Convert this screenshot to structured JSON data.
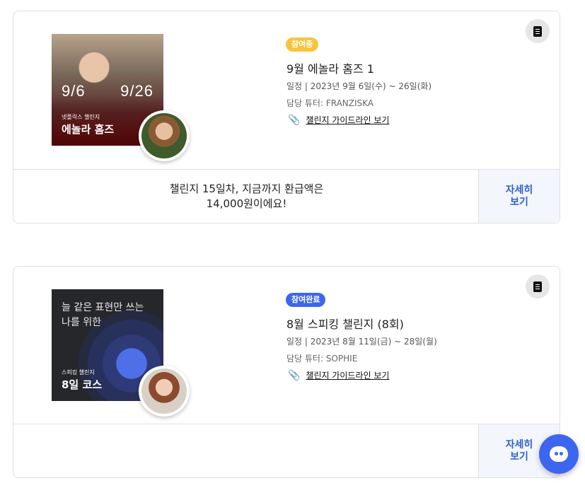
{
  "challenges": [
    {
      "badge": "참여중",
      "badge_color": "#f9c43a",
      "title": "9월 에놀라 홈즈 1",
      "schedule": "일정 |   2023년 9월 6일(수) ~ 26일(화)",
      "tutor": "담당 튜터: FRANZISKA",
      "guide_label": "챌린지 가이드라인 보기",
      "thumb": {
        "date_start": "9/6",
        "date_end": "9/26",
        "small_text": "넷플릭스 챌린지",
        "big_text": "에놀라 홈즈"
      },
      "refund_line1": "챌린지 15일차, 지금까지 환급액은",
      "refund_line2": "14,000원이에요!",
      "detail_line1": "자세히",
      "detail_line2": "보기"
    },
    {
      "badge": "참여완료",
      "badge_color": "#3d66f0",
      "title": "8월 스피킹 챌린지 (8회)",
      "schedule": "일정 |   2023년 8월 11일(금) ~ 28일(월)",
      "tutor": "담당 튜터: SOPHIE",
      "guide_label": "챌린지 가이드라인 보기",
      "thumb": {
        "head_line1": "늘 같은 표현만 쓰는",
        "head_line2": "나를 위한",
        "small_text": "스피킹 챌린지",
        "big_text": "8일 코스"
      },
      "detail_line1": "자세히",
      "detail_line2": "보기"
    }
  ],
  "icons": [
    "document-icon",
    "paperclip-icon",
    "chat-icon"
  ]
}
